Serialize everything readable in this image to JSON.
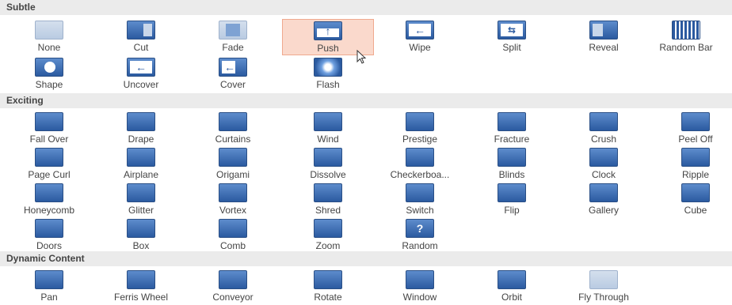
{
  "sections": [
    {
      "header": "Subtle",
      "rows": [
        [
          {
            "label": "None",
            "icon": "none-icon"
          },
          {
            "label": "Cut",
            "icon": "cut-icon"
          },
          {
            "label": "Fade",
            "icon": "fade-icon"
          },
          {
            "label": "Push",
            "icon": "push-up-arrow-icon"
          },
          {
            "label": "Wipe",
            "icon": "wipe-left-arrow-icon"
          },
          {
            "label": "Split",
            "icon": "split-arrows-icon"
          },
          {
            "label": "Reveal",
            "icon": "reveal-icon"
          },
          {
            "label": "Random Bar",
            "icon": "random-bars-icon"
          }
        ],
        [
          {
            "label": "Shape",
            "icon": "shape-circle-icon"
          },
          {
            "label": "Uncover",
            "icon": "uncover-arrow-icon"
          },
          {
            "label": "Cover",
            "icon": "cover-arrow-icon"
          },
          {
            "label": "Flash",
            "icon": "flash-icon"
          }
        ]
      ]
    },
    {
      "header": "Exciting",
      "rows": [
        [
          {
            "label": "Fall Over",
            "icon": "fall-over-icon"
          },
          {
            "label": "Drape",
            "icon": "drape-icon"
          },
          {
            "label": "Curtains",
            "icon": "curtains-icon"
          },
          {
            "label": "Wind",
            "icon": "wind-icon"
          },
          {
            "label": "Prestige",
            "icon": "prestige-icon"
          },
          {
            "label": "Fracture",
            "icon": "fracture-icon"
          },
          {
            "label": "Crush",
            "icon": "crush-icon"
          },
          {
            "label": "Peel Off",
            "icon": "peel-off-icon"
          }
        ],
        [
          {
            "label": "Page Curl",
            "icon": "page-curl-icon"
          },
          {
            "label": "Airplane",
            "icon": "airplane-icon"
          },
          {
            "label": "Origami",
            "icon": "origami-icon"
          },
          {
            "label": "Dissolve",
            "icon": "dissolve-icon"
          },
          {
            "label": "Checkerboa...",
            "icon": "checkerboard-icon"
          },
          {
            "label": "Blinds",
            "icon": "blinds-icon"
          },
          {
            "label": "Clock",
            "icon": "clock-icon"
          },
          {
            "label": "Ripple",
            "icon": "ripple-icon"
          }
        ],
        [
          {
            "label": "Honeycomb",
            "icon": "honeycomb-icon"
          },
          {
            "label": "Glitter",
            "icon": "glitter-icon"
          },
          {
            "label": "Vortex",
            "icon": "vortex-icon"
          },
          {
            "label": "Shred",
            "icon": "shred-icon"
          },
          {
            "label": "Switch",
            "icon": "switch-icon"
          },
          {
            "label": "Flip",
            "icon": "flip-icon"
          },
          {
            "label": "Gallery",
            "icon": "gallery-icon"
          },
          {
            "label": "Cube",
            "icon": "cube-icon"
          }
        ],
        [
          {
            "label": "Doors",
            "icon": "doors-icon"
          },
          {
            "label": "Box",
            "icon": "box-icon"
          },
          {
            "label": "Comb",
            "icon": "comb-icon"
          },
          {
            "label": "Zoom",
            "icon": "zoom-icon"
          },
          {
            "label": "Random",
            "icon": "random-question-icon",
            "glyph": "?"
          }
        ]
      ]
    },
    {
      "header": "Dynamic Content",
      "rows": [
        [
          {
            "label": "Pan",
            "icon": "pan-icon"
          },
          {
            "label": "Ferris Wheel",
            "icon": "ferris-wheel-icon"
          },
          {
            "label": "Conveyor",
            "icon": "conveyor-icon"
          },
          {
            "label": "Rotate",
            "icon": "rotate-icon"
          },
          {
            "label": "Window",
            "icon": "window-icon"
          },
          {
            "label": "Orbit",
            "icon": "orbit-icon"
          },
          {
            "label": "Fly Through",
            "icon": "fly-through-icon"
          }
        ]
      ]
    }
  ],
  "selected": "Push",
  "colors": {
    "accent": "#2b5aa0",
    "selected_bg": "#fad9cc",
    "header_bg": "#ebebeb"
  }
}
